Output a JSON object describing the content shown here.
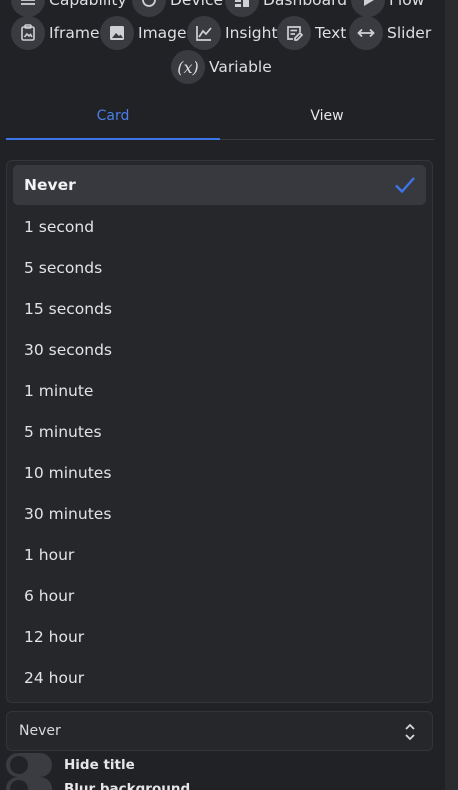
{
  "widgets": {
    "row1": [
      "Capability",
      "Device",
      "Dashboard",
      "Flow"
    ],
    "row2": [
      "Iframe",
      "Image",
      "Insight",
      "Text",
      "Slider"
    ],
    "row3": [
      "Variable"
    ],
    "variable_glyph": "(x)"
  },
  "tabs": {
    "card": "Card",
    "view": "View",
    "active": "Card"
  },
  "refresh_menu": {
    "selected": "Never",
    "options": [
      "Never",
      "1 second",
      "5 seconds",
      "15 seconds",
      "30 seconds",
      "1 minute",
      "5 minutes",
      "10 minutes",
      "30 minutes",
      "1 hour",
      "6 hour",
      "12 hour",
      "24 hour"
    ]
  },
  "refresh_select": {
    "value": "Never"
  },
  "toggles": [
    {
      "label": "Hide title",
      "on": false
    },
    {
      "label": "Blur background",
      "on": false
    }
  ],
  "colors": {
    "accent": "#3d74e6",
    "background": "#212226",
    "surface": "#26272b"
  }
}
